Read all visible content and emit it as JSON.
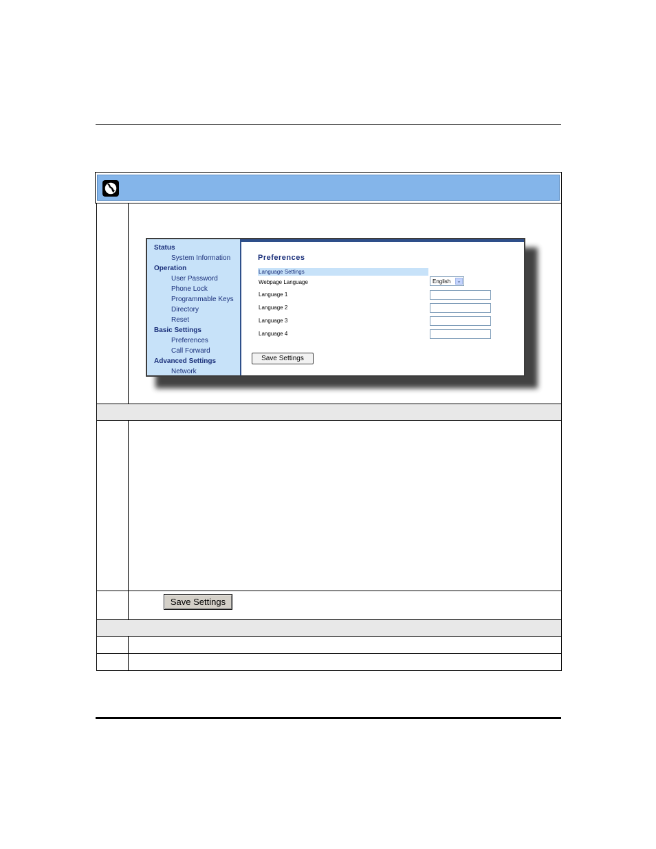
{
  "embedded_ui": {
    "nav": {
      "sections": [
        {
          "label": "Status",
          "items": [
            "System Information"
          ]
        },
        {
          "label": "Operation",
          "items": [
            "User Password",
            "Phone Lock",
            "Programmable Keys",
            "Directory",
            "Reset"
          ]
        },
        {
          "label": "Basic Settings",
          "items": [
            "Preferences",
            "Call Forward"
          ]
        },
        {
          "label": "Advanced Settings",
          "items": [
            "Network"
          ]
        }
      ]
    },
    "page_title": "Preferences",
    "section_header": "Language Settings",
    "fields": {
      "webpage_language_label": "Webpage Language",
      "webpage_language_value": "English",
      "language1_label": "Language 1",
      "language2_label": "Language 2",
      "language3_label": "Language 3",
      "language4_label": "Language 4"
    },
    "save_button": "Save Settings"
  },
  "step_button": {
    "label": "Save Settings"
  },
  "colors": {
    "banner": "#84b5ea",
    "nav_bg": "#c7e2f9",
    "nav_text": "#1a2f7a"
  },
  "icons": {
    "banner_icon": "globe-icon"
  }
}
